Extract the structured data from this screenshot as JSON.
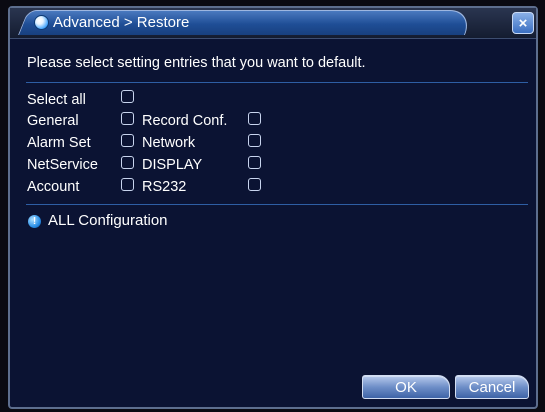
{
  "title": "Advanced > Restore",
  "close_label": "×",
  "instruction": "Please select setting entries that you want to default.",
  "select_all_label": "Select all",
  "entries_left": [
    "General",
    "Alarm Set",
    "NetService",
    "Account"
  ],
  "entries_right": [
    "Record Conf.",
    "Network",
    "DISPLAY",
    "RS232"
  ],
  "info_icon_glyph": "!",
  "info_text": "ALL Configuration",
  "ok_label": "OK",
  "cancel_label": "Cancel",
  "colors": {
    "panel_bg": "#0b1333",
    "accent": "#2e5ea4",
    "title_tab": "#1f4e96"
  }
}
